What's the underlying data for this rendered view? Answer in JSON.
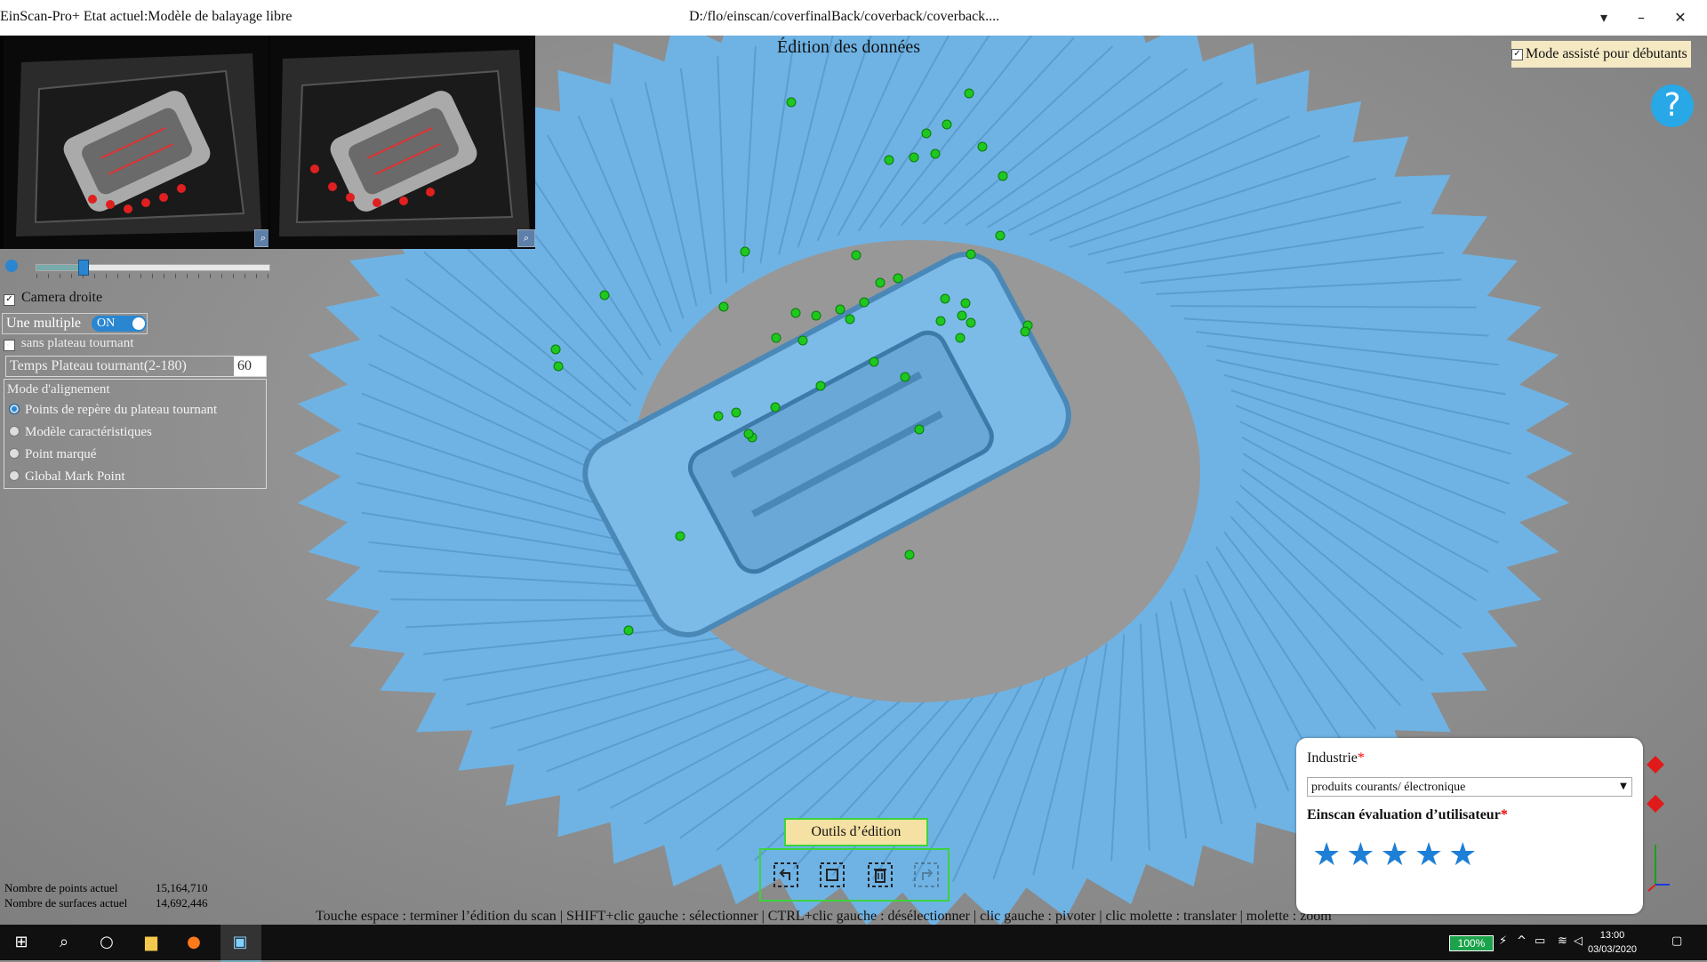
{
  "titlebar": {
    "app_title": "EinScan-Pro+ Etat actuel:Modèle de balayage libre",
    "file_path": "D:/flo/einscan/coverfinalBack/coverback/coverback....",
    "buttons": [
      "chevron-down",
      "minimize",
      "close"
    ]
  },
  "viewport": {
    "title": "Édition des données",
    "beginner_mode_label": "Mode assisté pour débutants",
    "beginner_mode_checked": true,
    "help_label": "?"
  },
  "left_panel": {
    "camera_right_label": "Camera droite",
    "camera_right_checked": true,
    "single_multiple_label": "Une multiple",
    "toggle_label": "ON",
    "turntable_label": "sans plateau tournant",
    "turntable_checked": true,
    "turntable_time_label": "Temps Plateau tournant(2-180)",
    "turntable_time_value": "60",
    "alignment_mode_label": "Mode d'alignement",
    "alignment_options": [
      {
        "label": "Points de repère du plateau tournant",
        "selected": true
      },
      {
        "label": "Modèle caractéristiques",
        "selected": false
      },
      {
        "label": "Point marqué",
        "selected": false
      },
      {
        "label": "Global Mark Point",
        "selected": false
      }
    ],
    "exposure_fraction": 0.2
  },
  "stats": {
    "points_label": "Nombre de points actuel",
    "points_value": "15,164,710",
    "surfaces_label": "Nombre de surfaces actuel",
    "surfaces_value": "14,692,446"
  },
  "edit_tools": {
    "label": "Outils d’édition",
    "tools": [
      "undo-select-icon",
      "select-region-icon",
      "delete-selection-icon",
      "redo-icon"
    ]
  },
  "hint_text": "Touche espace : terminer l’édition du scan | SHIFT+clic gauche : sélectionner | CTRL+clic gauche : désélectionner | clic gauche : pivoter | clic molette : translater | molette : zoom",
  "rating_panel": {
    "industry_label": "Industrie",
    "industry_required": "*",
    "industry_value": "produits courants/ électronique",
    "evaluation_label": "Einscan évaluation d’utilisateur",
    "evaluation_required": "*",
    "stars_filled": 5,
    "stars_total": 5
  },
  "taskbar": {
    "battery": "100%",
    "time": "13:00",
    "date": "03/03/2020"
  },
  "colors": {
    "scan_blue": "#6fb3e4",
    "marker_green": "#1ec81e",
    "accent_blue": "#2a86d0",
    "highlight_green": "#3cd43c",
    "star_blue": "#1e7fd6"
  }
}
